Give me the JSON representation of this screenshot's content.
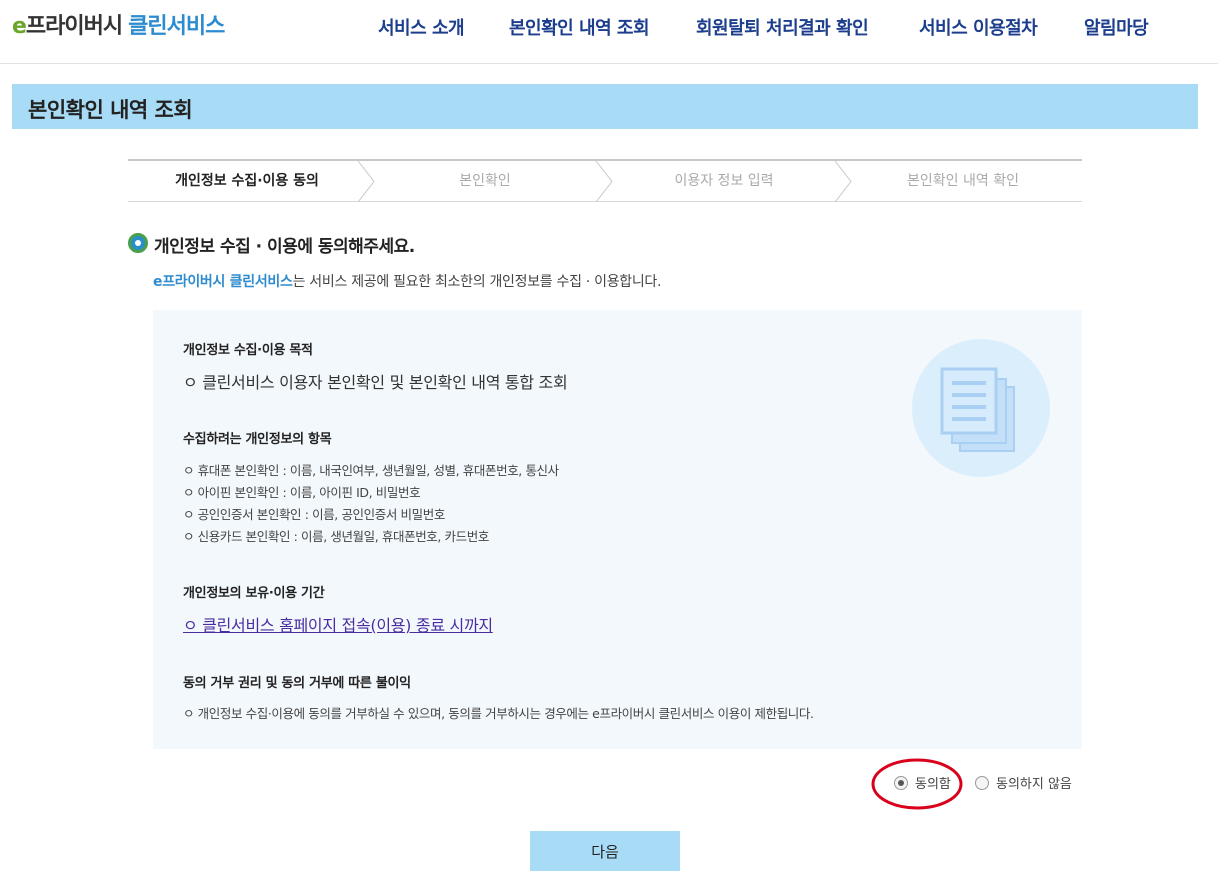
{
  "logo": {
    "e": "e",
    "prefix": "프라이버시",
    "suffix": "클린서비스"
  },
  "nav": [
    "서비스 소개",
    "본인확인 내역 조회",
    "회원탈퇴 처리결과 확인",
    "서비스 이용절차",
    "알림마당"
  ],
  "page_title": "본인확인 내역 조회",
  "steps": [
    "개인정보 수집·이용 동의",
    "본인확인",
    "이용자 정보 입력",
    "본인확인 내역 확인"
  ],
  "section": {
    "title": "개인정보 수집 · 이용에 동의해주세요.",
    "intro_brand": "e프라이버시 클린서비스",
    "intro_rest": "는 서비스 제공에 필요한 최소한의 개인정보를 수집 · 이용합니다."
  },
  "box": {
    "purpose_heading": "개인정보 수집·이용 목적",
    "purpose_text": "ㅇ 클린서비스 이용자 본인확인 및 본인확인 내역 통합 조회",
    "items_heading": "수집하려는 개인정보의 항목",
    "items": [
      "ㅇ 휴대폰 본인확인 : 이름, 내국인여부, 생년월일, 성별, 휴대폰번호, 통신사",
      "ㅇ 아이핀 본인확인 : 이름, 아이핀 ID, 비밀번호",
      "ㅇ 공인인증서 본인확인 : 이름, 공인인증서 비밀번호",
      "ㅇ 신용카드 본인확인 : 이름, 생년월일, 휴대폰번호, 카드번호"
    ],
    "retention_heading": "개인정보의 보유·이용 기간",
    "retention_text": "ㅇ 클린서비스 홈페이지 접속(이용) 종료 시까지",
    "refusal_heading": "동의 거부 권리 및 동의 거부에 따른 불이익",
    "refusal_text": "ㅇ 개인정보 수집·이용에 동의를 거부하실 수 있으며, 동의를 거부하시는 경우에는 e프라이버시 클린서비스 이용이 제한됩니다."
  },
  "consent": {
    "agree": "동의함",
    "disagree": "동의하지 않음",
    "selected": "agree"
  },
  "next_button": "다음",
  "colors": {
    "accent": "#a8dcf6",
    "brand_blue": "#2d8ccf",
    "brand_green": "#6aa629",
    "nav": "#1c3e8c",
    "annotation": "#d9001b"
  }
}
